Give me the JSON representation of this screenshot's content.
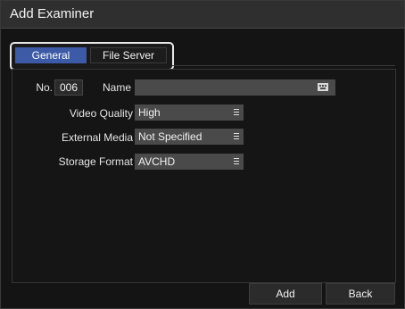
{
  "window": {
    "title": "Add Examiner"
  },
  "tabs": [
    {
      "label": "General",
      "selected": true
    },
    {
      "label": "File Server",
      "selected": false
    }
  ],
  "form": {
    "no_label": "No.",
    "no_value": "006",
    "name_label": "Name",
    "name_value": "",
    "video_quality_label": "Video Quality",
    "video_quality_value": "High",
    "external_media_label": "External Media",
    "external_media_value": "Not Specified",
    "storage_format_label": "Storage Format",
    "storage_format_value": "AVCHD"
  },
  "buttons": {
    "add": "Add",
    "back": "Back"
  },
  "colors": {
    "accent": "#3d5aa6",
    "background": "#141414",
    "field": "#4a4a4a"
  },
  "icons": [
    "keyboard-icon",
    "dropdown-list-icon"
  ]
}
